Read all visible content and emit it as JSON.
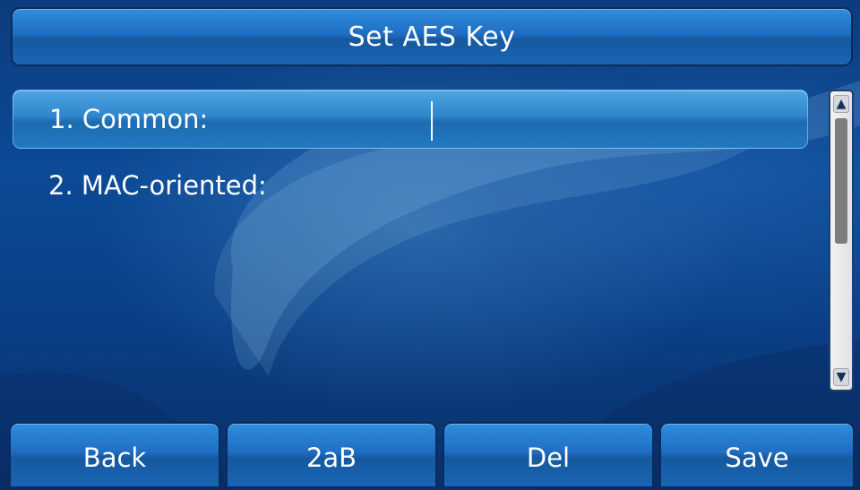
{
  "title": "Set AES Key",
  "items": [
    {
      "label": "1. Common:",
      "value": "",
      "selected": true
    },
    {
      "label": "2. MAC-oriented:",
      "value": "",
      "selected": false
    }
  ],
  "scrollbar": {
    "up_icon": "arrow-up-icon",
    "down_icon": "arrow-down-icon",
    "up_glyph": "▲",
    "down_glyph": "▼"
  },
  "softkeys": [
    {
      "label": "Back"
    },
    {
      "label": "2aB"
    },
    {
      "label": "Del"
    },
    {
      "label": "Save"
    }
  ],
  "colors": {
    "background": "#0b4a96",
    "bar": "#1f6ec4",
    "selected": "#2e86cc",
    "text": "#ffffff"
  }
}
